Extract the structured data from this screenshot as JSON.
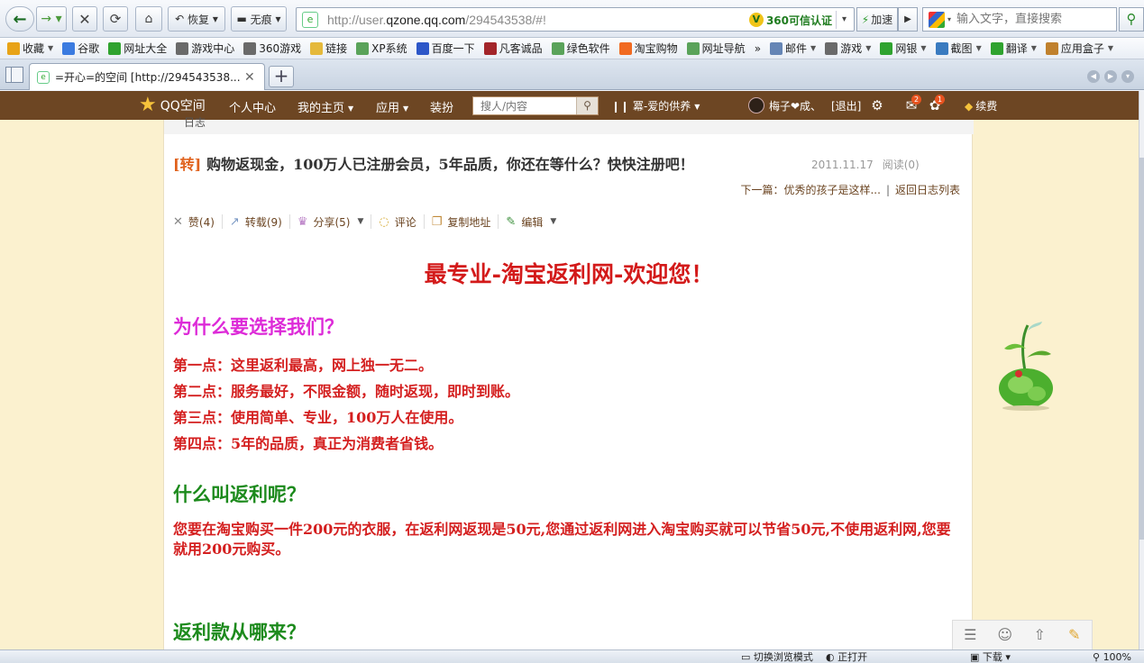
{
  "browser": {
    "restore_label": "恢复",
    "trace_label": "无痕",
    "url_prefix": "http://user.",
    "url_domain": "qzone.qq.com",
    "url_suffix": "/294543538/#!",
    "trust_label": "360可信认证",
    "speed_label": "加速",
    "search_placeholder": "输入文字，直接搜索"
  },
  "favorites": [
    {
      "label": "收藏",
      "icon": "star-icon",
      "color": "#e8a317",
      "dropdown": true
    },
    {
      "label": "谷歌",
      "icon": "google-icon",
      "color": "#3b7be0",
      "dropdown": false
    },
    {
      "label": "网址大全",
      "icon": "360-icon",
      "color": "#2fa32f",
      "dropdown": false
    },
    {
      "label": "游戏中心",
      "icon": "gamepad-icon",
      "color": "#6a6a6a",
      "dropdown": false
    },
    {
      "label": "360游戏",
      "icon": "gamepad-icon",
      "color": "#6a6a6a",
      "dropdown": false
    },
    {
      "label": "链接",
      "icon": "folder-icon",
      "color": "#e5b93b",
      "dropdown": false
    },
    {
      "label": "XP系统",
      "icon": "page-icon",
      "color": "#5aa35a",
      "dropdown": false
    },
    {
      "label": "百度一下",
      "icon": "baidu-icon",
      "color": "#2d57c8",
      "dropdown": false
    },
    {
      "label": "凡客诚品",
      "icon": "vancl-icon",
      "color": "#a3252a",
      "dropdown": false
    },
    {
      "label": "绿色软件",
      "icon": "page-icon",
      "color": "#5aa35a",
      "dropdown": false
    },
    {
      "label": "淘宝购物",
      "icon": "taobao-icon",
      "color": "#f16a21",
      "dropdown": false
    },
    {
      "label": "网址导航",
      "icon": "page-icon",
      "color": "#5aa35a",
      "dropdown": false
    },
    {
      "label": "»",
      "icon": "",
      "color": "",
      "dropdown": false
    },
    {
      "label": "邮件",
      "icon": "mail-icon",
      "color": "#6585b5",
      "dropdown": true
    },
    {
      "label": "游戏",
      "icon": "gamepad-icon",
      "color": "#6a6a6a",
      "dropdown": true
    },
    {
      "label": "网银",
      "icon": "bank-icon",
      "color": "#2fa32f",
      "dropdown": true
    },
    {
      "label": "截图",
      "icon": "screenshot-icon",
      "color": "#3a7bc0",
      "dropdown": true
    },
    {
      "label": "翻译",
      "icon": "translate-icon",
      "color": "#2fa32f",
      "dropdown": true
    },
    {
      "label": "应用盒子",
      "icon": "box-icon",
      "color": "#c0812d",
      "dropdown": true
    }
  ],
  "tab": {
    "title": "=开心=的空间 [http://294543538...."
  },
  "qzone": {
    "logo_text": "QQ空间",
    "nav": [
      {
        "label": "个人中心",
        "dropdown": false
      },
      {
        "label": "我的主页",
        "dropdown": true
      },
      {
        "label": "应用",
        "dropdown": true
      },
      {
        "label": "装扮",
        "dropdown": false
      }
    ],
    "search_placeholder": "搜人/内容",
    "music_label": "冪-爱的供养",
    "username": "梅子❤成、",
    "logout_label": "[退出]",
    "mail_badge": "2",
    "notify_badge": "1",
    "renew_label": "续费"
  },
  "post": {
    "section_label": "日志",
    "repost_tag": "[转]",
    "title": "购物返现金，100万人已注册会员，5年品质，你还在等什么？快快注册吧！",
    "date": "2011.11.17",
    "reads": "阅读(0)",
    "next_link": "下一篇：优秀的孩子是这样...",
    "back_link": "返回日志列表",
    "actions": {
      "like": "赞(4)",
      "repost": "转载(9)",
      "share": "分享(5)",
      "comment": "评论",
      "copy": "复制地址",
      "edit": "编辑"
    }
  },
  "content": {
    "headline": "最专业-淘宝返利网-欢迎您！",
    "why_heading": "为什么要选择我们？",
    "points": [
      "第一点：这里返利最高，网上独一无二。",
      "第二点：服务最好，不限金额，随时返现，即时到账。",
      "第三点：使用简单、专业，100万人在使用。",
      "第四点：5年的品质，真正为消费者省钱。"
    ],
    "what_heading": "什么叫返利呢？",
    "what_paragraph": "您要在淘宝购买一件200元的衣服，在返利网返现是50元,您通过返利网进入淘宝购买就可以节省50元,不使用返利网,您要就用200元购买。",
    "where_heading": "返利款从哪来？"
  },
  "statusbar": {
    "mode": "切换浏览模式",
    "quick": "正打开",
    "download": "下载",
    "zoom": "100%"
  }
}
